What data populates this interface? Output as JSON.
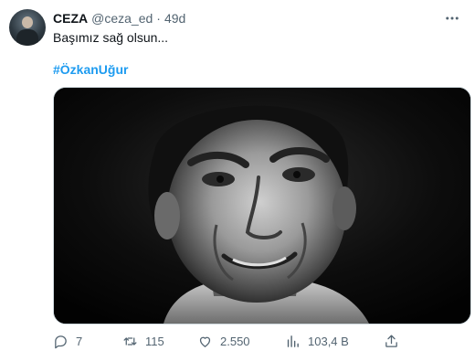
{
  "tweet": {
    "display_name": "CEZA",
    "handle": "@ceza_ed",
    "separator": "·",
    "time": "49d",
    "text": "Başımız sağ olsun...",
    "hashtag": "#ÖzkanUğur"
  },
  "actions": {
    "replies": "7",
    "retweets": "115",
    "likes": "2.550",
    "views": "103,4 B"
  },
  "colors": {
    "text": "#0f1419",
    "muted": "#536471",
    "hashtag": "#1d9bf0",
    "border": "#cfd9de"
  },
  "icons": [
    "avatar",
    "more-icon",
    "reply-icon",
    "retweet-icon",
    "like-icon",
    "views-icon",
    "share-icon"
  ]
}
